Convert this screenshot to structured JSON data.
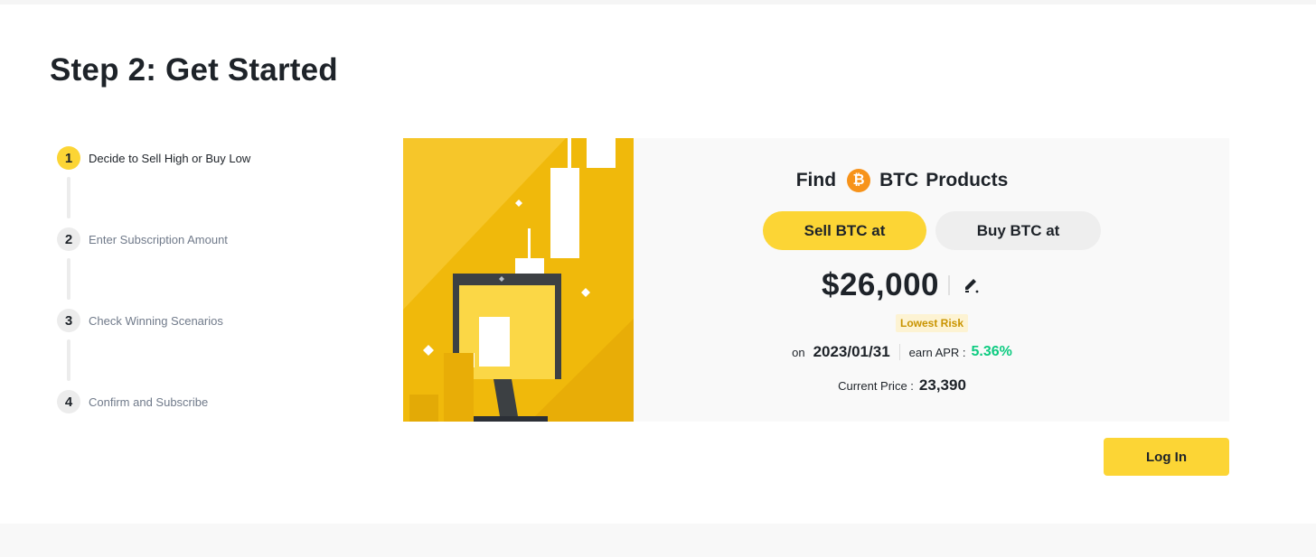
{
  "page": {
    "title": "Step 2: Get Started"
  },
  "steps": [
    {
      "number": "1",
      "label": "Decide to Sell High or Buy Low",
      "active": true
    },
    {
      "number": "2",
      "label": "Enter Subscription Amount",
      "active": false
    },
    {
      "number": "3",
      "label": "Check Winning Scenarios",
      "active": false
    },
    {
      "number": "4",
      "label": "Confirm and Subscribe",
      "active": false
    }
  ],
  "product": {
    "find_prefix": "Find",
    "asset": "BTC",
    "find_suffix": "Products",
    "coin_symbol": "₿",
    "sell_label": "Sell BTC at",
    "buy_label": "Buy BTC at",
    "target_price": "$26,000",
    "risk_badge": "Lowest Risk",
    "on_label": "on",
    "date": "2023/01/31",
    "apr_label": "earn APR :",
    "apr_value": "5.36%",
    "current_price_label": "Current Price :",
    "current_price": "23,390",
    "edit_icon": "edit-pencil-icon"
  },
  "actions": {
    "login_label": "Log In"
  },
  "colors": {
    "brand_yellow": "#fcd535",
    "btc_orange": "#f7931a",
    "apr_green": "#0ecb81",
    "risk_text": "#c99400",
    "risk_bg": "#fdf3d3"
  }
}
